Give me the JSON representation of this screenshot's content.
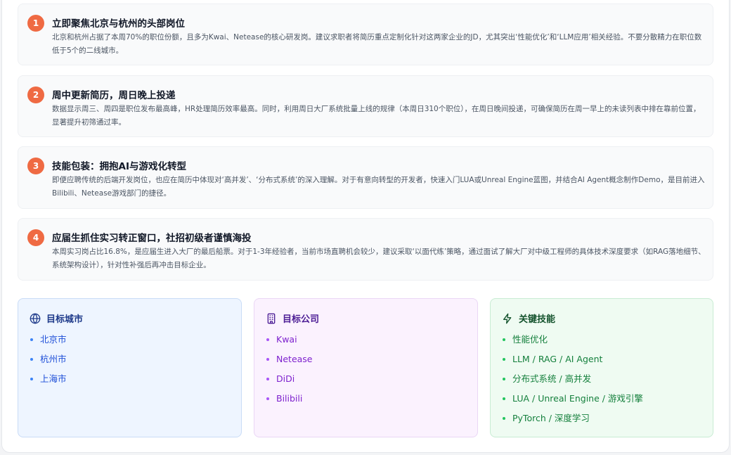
{
  "tips": [
    {
      "number": "1",
      "title": "立即聚焦北京与杭州的头部岗位",
      "desc": "北京和杭州占据了本周70%的职位份额，且多为Kwai、Netease的核心研发岗。建议求职者将简历重点定制化针对这两家企业的JD，尤其突出‘性能优化’和‘LLM应用’相关经验。不要分散精力在职位数低于5个的二线城市。"
    },
    {
      "number": "2",
      "title": "周中更新简历，周日晚上投递",
      "desc": "数据显示周三、周四是职位发布最高峰，HR处理简历效率最高。同时，利用周日大厂系统批量上线的规律（本周日310个职位），在周日晚间投递，可确保简历在周一早上的未读列表中排在靠前位置，显著提升初筛通过率。"
    },
    {
      "number": "3",
      "title": "技能包装：拥抱AI与游戏化转型",
      "desc": "即便应聘传统的后端开发岗位，也应在简历中体现对‘高并发’、‘分布式系统’的深入理解。对于有意向转型的开发者，快速入门LUA或Unreal Engine蓝图，并结合AI Agent概念制作Demo，是目前进入Bilibili、Netease游戏部门的捷径。"
    },
    {
      "number": "4",
      "title": "应届生抓住实习转正窗口，社招初级者谨慎海投",
      "desc": "本周实习岗占比16.8%，是应届生进入大厂的最后船票。对于1-3年经验者，当前市场直聘机会较少，建议采取‘以面代练’策略，通过面试了解大厂对中级工程师的具体技术深度要求（如RAG落地细节、系统架构设计），针对性补强后再冲击目标企业。"
    }
  ],
  "cards": {
    "cities": {
      "title": "目标城市",
      "icon": "globe-icon",
      "items": [
        "北京市",
        "杭州市",
        "上海市"
      ]
    },
    "companies": {
      "title": "目标公司",
      "icon": "building-icon",
      "items": [
        "Kwai",
        "Netease",
        "DiDi",
        "Bilibili"
      ]
    },
    "skills": {
      "title": "关键技能",
      "icon": "lightning-icon",
      "items": [
        "性能优化",
        "LLM / RAG / AI Agent",
        "分布式系统 / 高并发",
        "LUA / Unreal Engine / 游戏引擎",
        "PyTorch / 深度学习"
      ]
    }
  },
  "colors": {
    "accent": "#ef6a43",
    "cities": "#1d4ed8",
    "companies": "#7e22ce",
    "skills": "#15803d"
  }
}
